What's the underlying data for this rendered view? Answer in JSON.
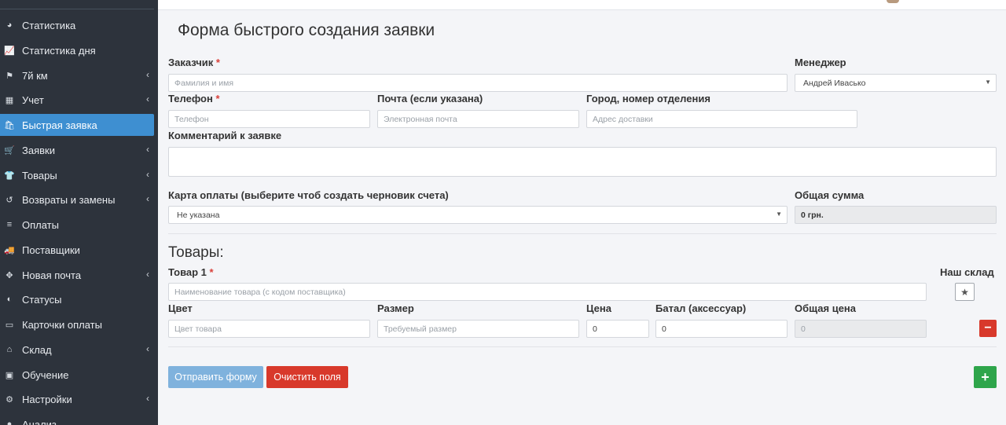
{
  "sidebar": {
    "items": [
      {
        "label": "Статистика",
        "icon": "dashboard-icon",
        "glyph": "◕",
        "has_submenu": false
      },
      {
        "label": "Статистика дня",
        "icon": "line-chart-icon",
        "glyph": "📈",
        "has_submenu": false
      },
      {
        "label": "7й км",
        "icon": "signpost-icon",
        "glyph": "⚑",
        "has_submenu": true
      },
      {
        "label": "Учет",
        "icon": "calculator-icon",
        "glyph": "▦",
        "has_submenu": true
      },
      {
        "label": "Быстрая заявка",
        "icon": "shopping-bag-icon",
        "glyph": "🛍",
        "has_submenu": false,
        "active": true
      },
      {
        "label": "Заявки",
        "icon": "shopping-cart-icon",
        "glyph": "🛒",
        "has_submenu": true
      },
      {
        "label": "Товары",
        "icon": "tshirt-icon",
        "glyph": "👕",
        "has_submenu": true
      },
      {
        "label": "Возвраты и замены",
        "icon": "undo-icon",
        "glyph": "↺",
        "has_submenu": true
      },
      {
        "label": "Оплаты",
        "icon": "coins-icon",
        "glyph": "≡",
        "has_submenu": false
      },
      {
        "label": "Поставщики",
        "icon": "truck-icon",
        "glyph": "🚚",
        "has_submenu": false
      },
      {
        "label": "Новая почта",
        "icon": "arrows-icon",
        "glyph": "✥",
        "has_submenu": true
      },
      {
        "label": "Статусы",
        "icon": "toggle-icon",
        "glyph": "◐",
        "has_submenu": false
      },
      {
        "label": "Карточки оплаты",
        "icon": "credit-card-icon",
        "glyph": "▭",
        "has_submenu": false
      },
      {
        "label": "Склад",
        "icon": "warehouse-icon",
        "glyph": "⌂",
        "has_submenu": true
      },
      {
        "label": "Обучение",
        "icon": "film-icon",
        "glyph": "▣",
        "has_submenu": false
      },
      {
        "label": "Настройки",
        "icon": "cogs-icon",
        "glyph": "⚙",
        "has_submenu": true
      },
      {
        "label": "Анализ",
        "icon": "analysis-icon",
        "glyph": "●",
        "has_submenu": false
      }
    ]
  },
  "page": {
    "title": "Форма быстрого создания заявки"
  },
  "form": {
    "customer": {
      "label": "Заказчик",
      "required": "*",
      "placeholder": "Фамилия и имя"
    },
    "manager": {
      "label": "Менеджер",
      "value": "Андрей Ивасько"
    },
    "phone": {
      "label": "Телефон",
      "required": "*",
      "placeholder": "Телефон"
    },
    "email": {
      "label": "Почта (если указана)",
      "placeholder": "Электронная почта"
    },
    "city": {
      "label": "Город, номер отделения",
      "placeholder": "Адрес доставки"
    },
    "comment": {
      "label": "Комментарий к заявке",
      "placeholder": ""
    },
    "card": {
      "label": "Карта оплаты (выберите чтоб создать черновик счета)",
      "value": "Не указана"
    },
    "total": {
      "label": "Общая сумма",
      "value": "0 грн."
    }
  },
  "products": {
    "section_title": "Товары:",
    "item_label": "Товар 1",
    "item_required": "*",
    "name_placeholder": "Наименование товара (с кодом поставщика)",
    "our_stock_label": "Наш склад",
    "color_label": "Цвет",
    "color_placeholder": "Цвет товара",
    "size_label": "Размер",
    "size_placeholder": "Требуемый размер",
    "price_label": "Цена",
    "price_value": "0",
    "batal_label": "Батал (аксессуар)",
    "batal_value": "0",
    "total_price_label": "Общая цена",
    "total_price_value": "0"
  },
  "actions": {
    "send_label": "Отправить форму",
    "clear_label": "Очистить поля",
    "add_label": "+",
    "remove_label": "−",
    "star_glyph": "★"
  }
}
